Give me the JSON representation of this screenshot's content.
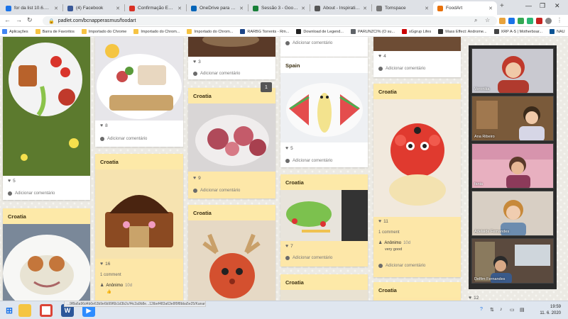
{
  "browser": {
    "tabs": [
      {
        "label": "for da list 10.6.2020 - Ca",
        "color": "#1a73e8"
      },
      {
        "label": "(4) Facebook",
        "color": "#3b5998"
      },
      {
        "label": "Confirmação Encontro",
        "color": "#d93025"
      },
      {
        "label": "OneDrive para Empresa",
        "color": "#0364b8"
      },
      {
        "label": "Sessão 3 - Google Drive",
        "color": "#188038"
      },
      {
        "label": "About - Inspirational E",
        "color": "#555555"
      },
      {
        "label": "Tomspace",
        "color": "#777777"
      },
      {
        "label": "FoodArt",
        "color": "#e8710a"
      }
    ],
    "url": "padlet.com/bcnapperasmus/foodart",
    "bookmarks": [
      {
        "label": "Aplicações",
        "color": "#4285f4"
      },
      {
        "label": "Barra de Favoritos",
        "color": "#f6c343"
      },
      {
        "label": "Importado do Chrome",
        "color": "#f6c343"
      },
      {
        "label": "Importado do Chrom...",
        "color": "#f6c343"
      },
      {
        "label": "Importado do Chrom...",
        "color": "#f6c343"
      },
      {
        "label": "RARBG Torrents - Rm...",
        "color": "#1c4587"
      },
      {
        "label": "Download de Legend...",
        "color": "#222222"
      },
      {
        "label": "PARUNZCI% (O su...",
        "color": "#5f6368"
      },
      {
        "label": "sGgrup Lifes",
        "color": "#cc0000"
      },
      {
        "label": "Mass Effect: Androme...",
        "color": "#333333"
      },
      {
        "label": "XRP A-S | Motherboar...",
        "color": "#444444"
      },
      {
        "label": "NAU",
        "color": "#0b5394"
      }
    ]
  },
  "padlet": {
    "col1": {
      "card1": {
        "likes": "5",
        "comment_prompt": "Adicionar comentário"
      },
      "card2": {
        "title": "Croatia"
      }
    },
    "col2": {
      "card1": {
        "likes": "8",
        "comment_prompt": "Adicionar comentário"
      },
      "card2": {
        "title": "Croatia",
        "likes": "16",
        "comments": "1 comment",
        "author": "Anônimo",
        "time": "10d",
        "reply": "👍"
      }
    },
    "col3": {
      "card1": {
        "likes": "3",
        "comment_prompt": "Adicionar comentário"
      },
      "card2": {
        "title": "Croatia",
        "likes": "9",
        "comment_prompt": "Adicionar comentário"
      },
      "card3": {
        "title": "Croatia"
      }
    },
    "col4": {
      "card1": {
        "comment_prompt": "Adicionar comentário"
      },
      "card2": {
        "title": "Spain",
        "likes": "5",
        "comment_prompt": "Adicionar comentário"
      },
      "card3": {
        "title": "Croatia",
        "likes": "7",
        "comment_prompt": "Adicionar comentário"
      },
      "card4": {
        "title": "Croatia"
      }
    },
    "col5": {
      "card1": {
        "likes": "4",
        "comment_prompt": "Adicionar comentário"
      },
      "card2": {
        "title": "Croatia",
        "likes": "11",
        "comments": "1 comment",
        "author": "Anônimo",
        "time": "10d",
        "reply": "very good",
        "comment_prompt": "Adicionar comentário"
      },
      "card3": {
        "title": "Croatia",
        "likes": "12"
      }
    },
    "badge": "1"
  },
  "video": {
    "participants": [
      {
        "name": "Veronika"
      },
      {
        "name": "Ana Ribeiro"
      },
      {
        "name": "fania"
      },
      {
        "name": "Adelaide Fernandes"
      },
      {
        "name": "Delfim Fernandes"
      }
    ]
  },
  "status": {
    "url": "...9f8a6a96d4b0e63b9e6b99f6b1d3b2c/f4c2a9b8e...12tbef483a63e8f9f8bba5e25/Kanan_foodart.jpg"
  },
  "taskbar": {
    "time": "19:59",
    "date": "11. 6. 2020"
  }
}
